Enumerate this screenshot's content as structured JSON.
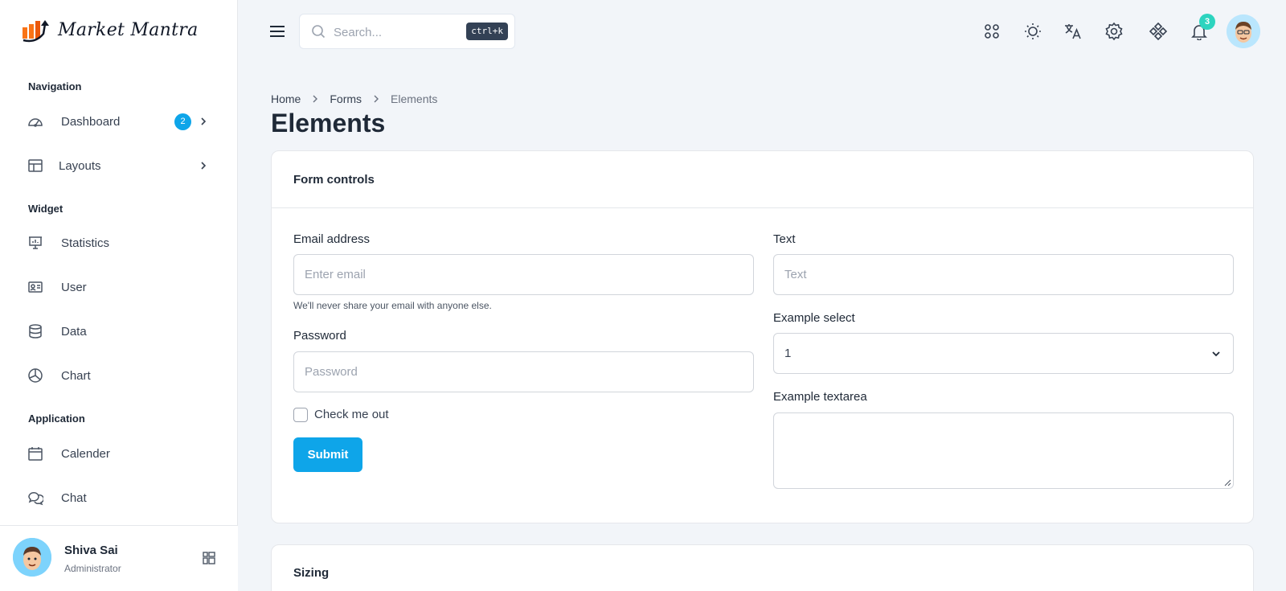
{
  "brand": {
    "name": "Market Mantra"
  },
  "sidebar": {
    "sections": [
      {
        "title": "Navigation"
      },
      {
        "title": "Widget"
      },
      {
        "title": "Application"
      }
    ],
    "items": [
      {
        "label": "Dashboard",
        "icon": "gauge-icon",
        "badge": "2",
        "has_chevron": true
      },
      {
        "label": "Layouts",
        "icon": "layout-icon",
        "has_chevron": true
      },
      {
        "label": "Statistics",
        "icon": "presentation-chart-icon"
      },
      {
        "label": "User",
        "icon": "id-card-icon"
      },
      {
        "label": "Data",
        "icon": "database-icon"
      },
      {
        "label": "Chart",
        "icon": "pie-chart-icon"
      },
      {
        "label": "Calender",
        "icon": "calendar-icon"
      },
      {
        "label": "Chat",
        "icon": "chat-bubbles-icon"
      }
    ],
    "user": {
      "name": "Shiva Sai",
      "role": "Administrator"
    }
  },
  "topbar": {
    "search_placeholder": "Search...",
    "shortcut": "ctrl+k",
    "icons": [
      "apps-grid-icon",
      "sun-icon",
      "translate-icon",
      "settings-gear-icon",
      "diamond-grid-icon",
      "bell-icon"
    ],
    "notification_count": "3"
  },
  "breadcrumb": {
    "home": "Home",
    "forms": "Forms",
    "current": "Elements"
  },
  "page_title": "Elements",
  "form_controls": {
    "title": "Form controls",
    "email_label": "Email address",
    "email_placeholder": "Enter email",
    "email_help": "We'll never share your email with anyone else.",
    "password_label": "Password",
    "password_placeholder": "Password",
    "check_label": "Check me out",
    "submit_label": "Submit",
    "text_label": "Text",
    "text_placeholder": "Text",
    "select_label": "Example select",
    "select_value": "1",
    "textarea_label": "Example textarea"
  },
  "sizing": {
    "title": "Sizing"
  },
  "colors": {
    "accent": "#0ea5e9",
    "notif_badge": "#2dd4bf",
    "logo_orange": "#f97316"
  }
}
